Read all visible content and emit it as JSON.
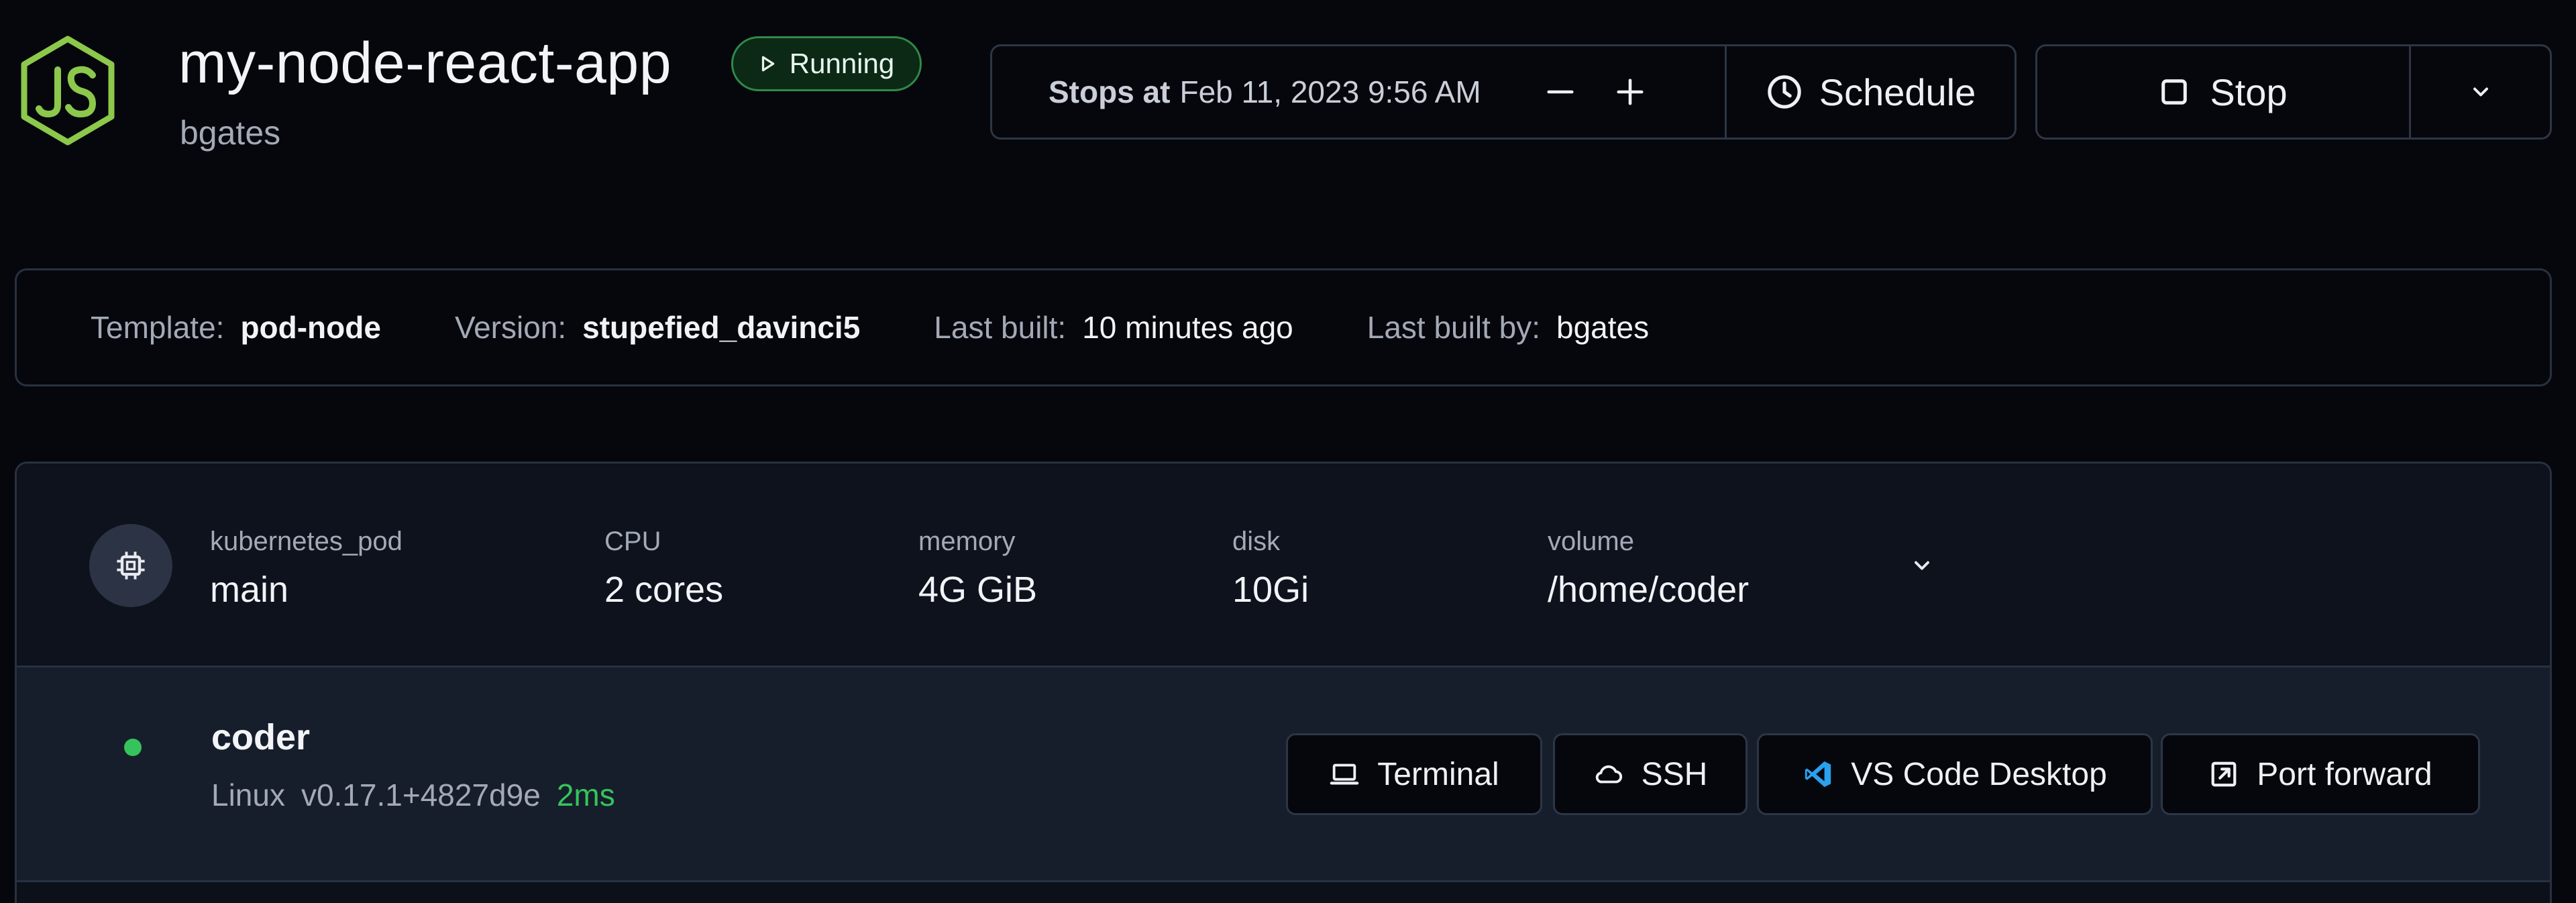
{
  "workspace": {
    "name": "my-node-react-app",
    "owner": "bgates",
    "status": "Running",
    "logo_icon": "nodejs-logo-icon"
  },
  "schedule": {
    "stops_label": "Stops at",
    "stops_time": "Feb 11, 2023 9:56 AM",
    "schedule_label": "Schedule"
  },
  "actions": {
    "stop_label": "Stop"
  },
  "stats": {
    "template_label": "Template:",
    "template_value": "pod-node",
    "version_label": "Version:",
    "version_value": "stupefied_davinci5",
    "last_built_label": "Last built:",
    "last_built_value": "10 minutes ago",
    "last_built_by_label": "Last built by:",
    "last_built_by_value": "bgates"
  },
  "resource": {
    "type_label": "kubernetes_pod",
    "name": "main",
    "cpu_label": "CPU",
    "cpu_value": "2 cores",
    "memory_label": "memory",
    "memory_value": "4G GiB",
    "disk_label": "disk",
    "disk_value": "10Gi",
    "volume_label": "volume",
    "volume_value": "/home/coder"
  },
  "agent": {
    "name": "coder",
    "os": "Linux",
    "version": "v0.17.1+4827d9e",
    "latency": "2ms",
    "status_color": "#35c45c",
    "buttons": {
      "terminal": "Terminal",
      "ssh": "SSH",
      "vscode": "VS Code Desktop",
      "port_forward": "Port forward"
    }
  },
  "colors": {
    "background": "#06070c",
    "running_green": "#2f8a48",
    "latency_green": "#35c45c",
    "vscode_blue": "#2aa0ef",
    "nodejs_green": "#8cc84b"
  }
}
